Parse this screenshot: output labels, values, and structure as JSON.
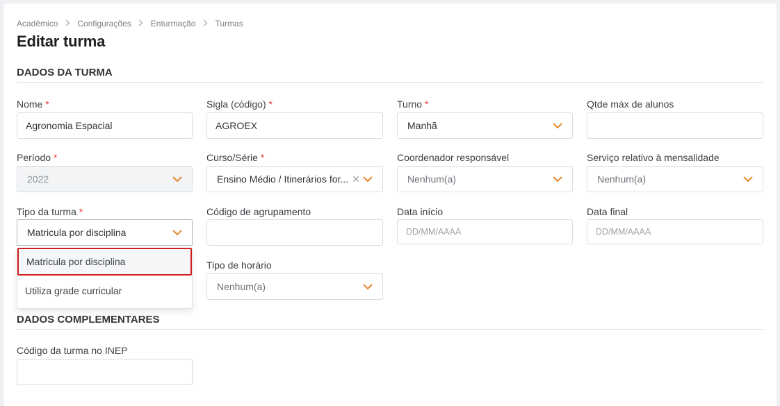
{
  "breadcrumb": [
    "Acadêmico",
    "Configurações",
    "Enturmação",
    "Turmas"
  ],
  "page_title": "Editar turma",
  "sections": {
    "dados_turma": "DADOS DA TURMA",
    "dados_complementares": "DADOS COMPLEMENTARES"
  },
  "fields": {
    "nome": {
      "label": "Nome",
      "required": "*",
      "value": "Agronomia Espacial"
    },
    "sigla": {
      "label": "Sigla (código)",
      "required": "*",
      "value": "AGROEX"
    },
    "turno": {
      "label": "Turno",
      "required": "*",
      "value": "Manhã"
    },
    "qtde": {
      "label": "Qtde máx de alunos",
      "value": ""
    },
    "periodo": {
      "label": "Período",
      "required": "*",
      "value": "2022"
    },
    "curso": {
      "label": "Curso/Série",
      "required": "*",
      "value": "Ensino Médio / Itinerários for..."
    },
    "coordenador": {
      "label": "Coordenador responsável",
      "value": "Nenhum(a)"
    },
    "servico": {
      "label": "Serviço relativo à mensalidade",
      "value": "Nenhum(a)"
    },
    "tipo_turma": {
      "label": "Tipo da turma",
      "required": "*",
      "value": "Matricula por disciplina"
    },
    "agrupamento": {
      "label": "Código de agrupamento",
      "value": ""
    },
    "data_inicio": {
      "label": "Data início",
      "placeholder": "DD/MM/AAAA"
    },
    "data_final": {
      "label": "Data final",
      "placeholder": "DD/MM/AAAA"
    },
    "tipo_horario": {
      "label": "Tipo de horário",
      "value": "Nenhum(a)"
    },
    "inep": {
      "label": "Código da turma no INEP",
      "value": ""
    }
  },
  "tipo_turma_options": [
    "Matricula por disciplina",
    "Utiliza grade curricular"
  ],
  "colors": {
    "accent": "#e8862c",
    "required": "#e03c3c",
    "highlight": "#d11f1f"
  }
}
